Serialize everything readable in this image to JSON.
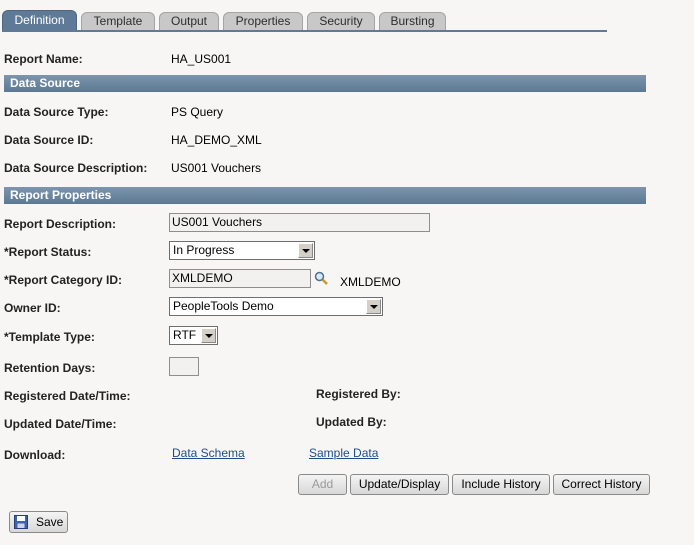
{
  "tabs": [
    {
      "label": "Definition",
      "active": true
    },
    {
      "label": "Template"
    },
    {
      "label": "Output"
    },
    {
      "label": "Properties"
    },
    {
      "label": "Security"
    },
    {
      "label": "Bursting"
    }
  ],
  "report_name": {
    "label": "Report Name:",
    "value": "HA_US001"
  },
  "data_source": {
    "header": "Data Source",
    "type": {
      "label": "Data Source Type:",
      "value": "PS Query"
    },
    "id": {
      "label": "Data Source ID:",
      "value": "HA_DEMO_XML"
    },
    "description": {
      "label": "Data Source Description:",
      "value": "US001 Vouchers"
    }
  },
  "report_properties": {
    "header": "Report Properties",
    "description": {
      "label": "Report Description:",
      "value": "US001 Vouchers"
    },
    "status": {
      "label": "*Report Status:",
      "value": "In Progress"
    },
    "category": {
      "label": "*Report Category ID:",
      "value": "XMLDEMO",
      "display": "XMLDEMO"
    },
    "owner": {
      "label": "Owner ID:",
      "value": "PeopleTools Demo"
    },
    "template_type": {
      "label": "*Template Type:",
      "value": "RTF"
    },
    "retention": {
      "label": "Retention Days:",
      "value": ""
    },
    "registered_datetime": {
      "label": "Registered Date/Time:"
    },
    "registered_by": {
      "label": "Registered By:"
    },
    "updated_datetime": {
      "label": "Updated Date/Time:"
    },
    "updated_by": {
      "label": "Updated By:"
    },
    "download": {
      "label": "Download:",
      "schema_link": "Data Schema",
      "sample_link": "Sample Data"
    }
  },
  "buttons": {
    "add": "Add",
    "update_display": "Update/Display",
    "include_history": "Include History",
    "correct_history": "Correct History",
    "save": "Save"
  },
  "colors": {
    "accent": "#5e7a96",
    "section_bar": "#6a849f",
    "link": "#1f4d8a"
  }
}
